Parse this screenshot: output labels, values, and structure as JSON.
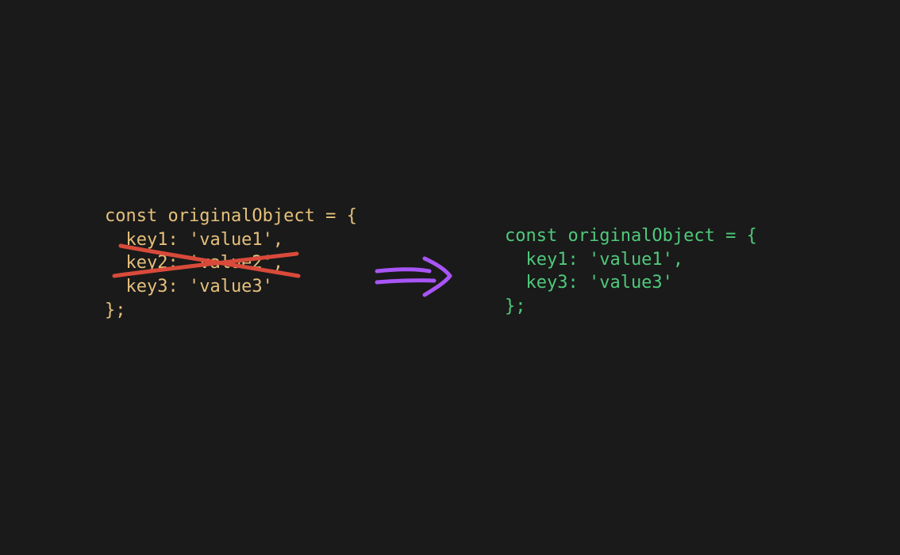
{
  "left": {
    "line1": "const originalObject = {",
    "line2": "  key1: 'value1',",
    "line3": "  key2: 'value2',",
    "line4": "  key3: 'value3'",
    "line5": "};"
  },
  "right": {
    "line1": "const originalObject = {",
    "line2": "  key1: 'value1',",
    "line3": "  key3: 'value3'",
    "line4": "};"
  },
  "colors": {
    "leftText": "#e5c07b",
    "rightText": "#4fc97b",
    "strike": "#d94a3a",
    "arrow": "#a855f7",
    "bg": "#1a1a1a"
  }
}
